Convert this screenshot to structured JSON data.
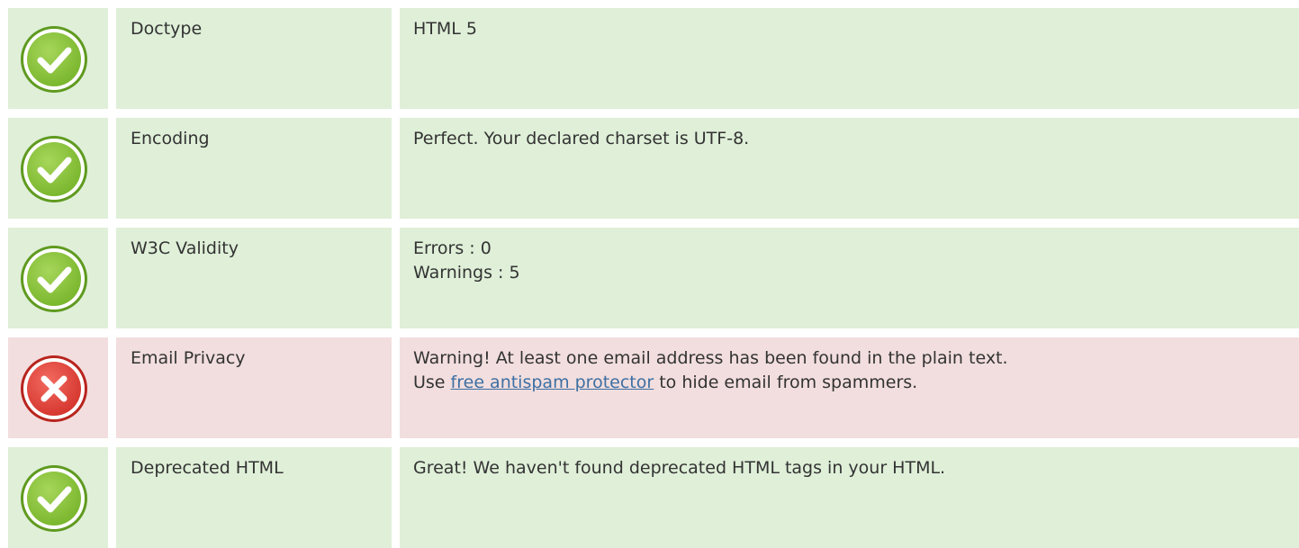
{
  "colors": {
    "pass_row": "#dfefd8",
    "fail_row": "#f2dede",
    "link": "#3d6fa3",
    "pass_icon": "#8cc63f",
    "fail_icon": "#e2463d"
  },
  "rows": [
    {
      "status": "pass",
      "icon": "check-icon",
      "name": "Doctype",
      "lines": [
        "HTML 5"
      ]
    },
    {
      "status": "pass",
      "icon": "check-icon",
      "name": "Encoding",
      "lines": [
        "Perfect. Your declared charset is UTF-8."
      ]
    },
    {
      "status": "pass",
      "icon": "check-icon",
      "name": "W3C Validity",
      "lines": [
        "Errors : 0",
        "Warnings : 5"
      ]
    },
    {
      "status": "fail",
      "icon": "cross-icon",
      "name": "Email Privacy",
      "lines": [
        "Warning! At least one email address has been found in the plain text."
      ],
      "second_line": {
        "prefix": "Use ",
        "link_text": "free antispam protector",
        "suffix": " to hide email from spammers."
      }
    },
    {
      "status": "pass",
      "icon": "check-icon",
      "name": "Deprecated HTML",
      "lines": [
        "Great! We haven't found deprecated HTML tags in your HTML."
      ]
    }
  ]
}
